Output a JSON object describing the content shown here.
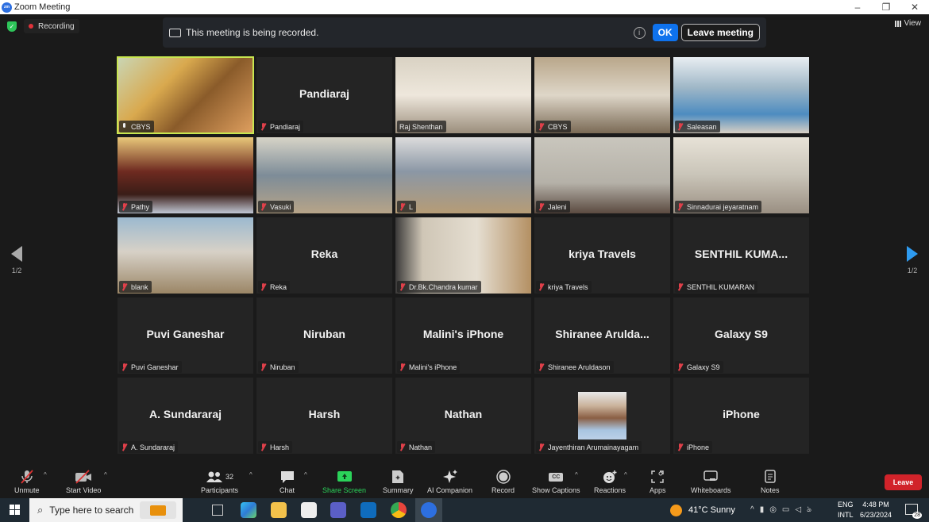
{
  "window": {
    "title": "Zoom Meeting",
    "minimize": "–",
    "restore": "❐",
    "close": "✕"
  },
  "status": {
    "recording_label": "Recording",
    "view_label": "View"
  },
  "banner": {
    "message": "This meeting is being recorded.",
    "ok_label": "OK",
    "leave_label": "Leave meeting"
  },
  "pagination": {
    "left": "1/2",
    "right": "1/2"
  },
  "tiles": [
    {
      "display": "",
      "name": "CBYS",
      "video": "v1",
      "mic": "on",
      "active": true
    },
    {
      "display": "Pandiaraj",
      "name": "Pandiaraj",
      "video": "",
      "mic": "muted"
    },
    {
      "display": "",
      "name": "Raj Shenthan",
      "video": "v2",
      "mic": "none"
    },
    {
      "display": "",
      "name": "CBYS",
      "video": "v3",
      "mic": "muted"
    },
    {
      "display": "",
      "name": "Saleasan",
      "video": "v4",
      "mic": "muted"
    },
    {
      "display": "",
      "name": "Pathy",
      "video": "v5",
      "mic": "muted"
    },
    {
      "display": "",
      "name": "Vasuki",
      "video": "v6",
      "mic": "muted"
    },
    {
      "display": "",
      "name": "L",
      "video": "v7",
      "mic": "muted"
    },
    {
      "display": "",
      "name": "Jaleni",
      "video": "v8",
      "mic": "muted"
    },
    {
      "display": "",
      "name": "Sinnadurai jeyaratnam",
      "video": "v9",
      "mic": "muted"
    },
    {
      "display": "",
      "name": "blank",
      "video": "v10",
      "mic": "muted"
    },
    {
      "display": "Reka",
      "name": "Reka",
      "video": "",
      "mic": "muted"
    },
    {
      "display": "",
      "name": "Dr.Bk.Chandra kumar",
      "video": "v11",
      "mic": "muted"
    },
    {
      "display": "kriya Travels",
      "name": "kriya Travels",
      "video": "",
      "mic": "muted"
    },
    {
      "display": "SENTHIL  KUMA...",
      "name": "SENTHIL KUMARAN",
      "video": "",
      "mic": "muted"
    },
    {
      "display": "Puvi Ganeshar",
      "name": "Puvi Ganeshar",
      "video": "",
      "mic": "muted"
    },
    {
      "display": "Niruban",
      "name": "Niruban",
      "video": "",
      "mic": "muted"
    },
    {
      "display": "Malini's iPhone",
      "name": "Malini's iPhone",
      "video": "",
      "mic": "muted"
    },
    {
      "display": "Shiranee  Arulda...",
      "name": "Shiranee Aruldason",
      "video": "",
      "mic": "muted"
    },
    {
      "display": "Galaxy S9",
      "name": "Galaxy S9",
      "video": "",
      "mic": "muted"
    },
    {
      "display": "A. Sundararaj",
      "name": "A. Sundararaj",
      "video": "",
      "mic": "muted"
    },
    {
      "display": "Harsh",
      "name": "Harsh",
      "video": "",
      "mic": "muted"
    },
    {
      "display": "Nathan",
      "name": "Nathan",
      "video": "",
      "mic": "muted"
    },
    {
      "display": "",
      "name": "Jayenthiran Arumainayagam",
      "video": "photo",
      "mic": "muted"
    },
    {
      "display": "iPhone",
      "name": "iPhone",
      "video": "",
      "mic": "muted"
    }
  ],
  "toolbar": {
    "unmute": "Unmute",
    "start_video": "Start Video",
    "participants": "Participants",
    "participants_count": "32",
    "chat": "Chat",
    "share_screen": "Share Screen",
    "summary": "Summary",
    "ai_companion": "AI Companion",
    "record": "Record",
    "show_captions": "Show Captions",
    "captions_glyph": "CC",
    "reactions": "Reactions",
    "apps": "Apps",
    "whiteboards": "Whiteboards",
    "notes": "Notes",
    "leave": "Leave",
    "share_color": "#2bd35a",
    "leave_color": "#d1232a"
  },
  "taskbar": {
    "search_placeholder": "Type here to search",
    "weather": "41°C  Sunny",
    "lang_top": "ENG",
    "lang_bottom": "INTL",
    "time": "4:48 PM",
    "date": "6/23/2024",
    "notifications": "28"
  }
}
